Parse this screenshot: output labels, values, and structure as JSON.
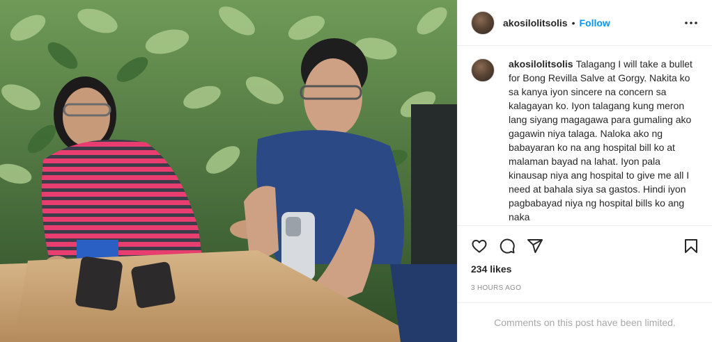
{
  "post": {
    "username": "akosilolitsolis",
    "follow_label": "Follow",
    "separator": "•",
    "caption_text": "Talagang I will take a bullet for Bong Revilla Salve at Gorgy. Nakita ko sa kanya iyon sincere na concern sa kalagayan ko. Iyon talagang kung meron lang siyang magagawa para gumaling ako gagawin niya talaga. Naloka ako ng babayaran ko na ang hospital bill ko at malaman bayad na lahat. Iyon pala kinausap niya ang hospital to give me all I need at bahala siya sa gastos. Hindi iyon pagbabayad niya ng hospital bills ko ang naka",
    "likes": "234 likes",
    "time_ago": "3 HOURS AGO",
    "comments_limited": "Comments on this post have been limited."
  },
  "icons": {
    "more": "more-options-icon",
    "like": "heart-icon",
    "comment": "comment-icon",
    "share": "share-icon",
    "save": "bookmark-icon"
  },
  "colors": {
    "follow": "#0095f6",
    "muted": "#8e8e8e",
    "text": "#262626"
  }
}
